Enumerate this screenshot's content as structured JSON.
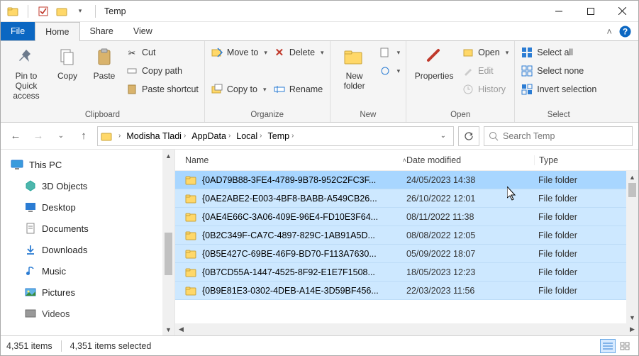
{
  "window": {
    "title": "Temp"
  },
  "tabs": {
    "file": "File",
    "home": "Home",
    "share": "Share",
    "view": "View"
  },
  "ribbon": {
    "clipboard": {
      "label": "Clipboard",
      "pin": "Pin to Quick access",
      "copy": "Copy",
      "paste": "Paste",
      "cut": "Cut",
      "copy_path": "Copy path",
      "paste_shortcut": "Paste shortcut"
    },
    "organize": {
      "label": "Organize",
      "move_to": "Move to",
      "copy_to": "Copy to",
      "delete": "Delete",
      "rename": "Rename"
    },
    "new": {
      "label": "New",
      "new_folder": "New folder"
    },
    "open": {
      "label": "Open",
      "properties": "Properties",
      "open": "Open",
      "edit": "Edit",
      "history": "History"
    },
    "select": {
      "label": "Select",
      "select_all": "Select all",
      "select_none": "Select none",
      "invert": "Invert selection"
    }
  },
  "breadcrumbs": [
    "Modisha Tladi",
    "AppData",
    "Local",
    "Temp"
  ],
  "search": {
    "placeholder": "Search Temp"
  },
  "nav": {
    "this_pc": "This PC",
    "items": [
      "3D Objects",
      "Desktop",
      "Documents",
      "Downloads",
      "Music",
      "Pictures",
      "Videos"
    ]
  },
  "columns": {
    "name": "Name",
    "date": "Date modified",
    "type": "Type"
  },
  "rows": [
    {
      "name": "{0AD79B88-3FE4-4789-9B78-952C2FC3F...",
      "date": "24/05/2023 14:38",
      "type": "File folder"
    },
    {
      "name": "{0AE2ABE2-E003-4BF8-BABB-A549CB26...",
      "date": "26/10/2022 12:01",
      "type": "File folder"
    },
    {
      "name": "{0AE4E66C-3A06-409E-96E4-FD10E3F64...",
      "date": "08/11/2022 11:38",
      "type": "File folder"
    },
    {
      "name": "{0B2C349F-CA7C-4897-829C-1AB91A5D...",
      "date": "08/08/2022 12:05",
      "type": "File folder"
    },
    {
      "name": "{0B5E427C-69BE-46F9-BD70-F113A7630...",
      "date": "05/09/2022 18:07",
      "type": "File folder"
    },
    {
      "name": "{0B7CD55A-1447-4525-8F92-E1E7F1508...",
      "date": "18/05/2023 12:23",
      "type": "File folder"
    },
    {
      "name": "{0B9E81E3-0302-4DEB-A14E-3D59BF456...",
      "date": "22/03/2023 11:56",
      "type": "File folder"
    }
  ],
  "status": {
    "count": "4,351 items",
    "selected": "4,351 items selected"
  }
}
